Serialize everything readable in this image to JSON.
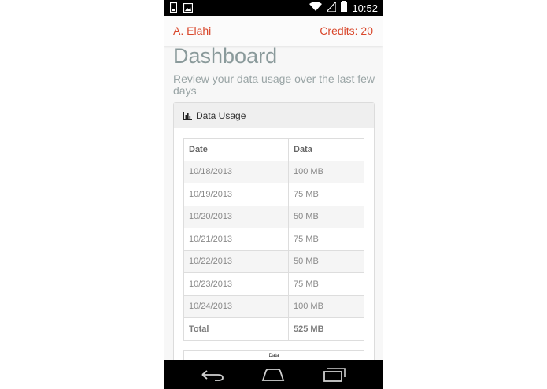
{
  "statusbar": {
    "time": "10:52",
    "left_icons": [
      "phone-notification-icon",
      "image-notification-icon"
    ],
    "right_icons": [
      "wifi-icon",
      "signal-icon",
      "battery-icon"
    ]
  },
  "header": {
    "user_name": "A. Elahi",
    "credits": "Credits: 20",
    "accent_color": "#d9472b"
  },
  "page": {
    "title": "Dashboard",
    "subtitle": "Review your data usage over the last few days"
  },
  "panel": {
    "icon": "bar-chart-icon",
    "title": "Data Usage",
    "table": {
      "columns": [
        "Date",
        "Data"
      ],
      "rows": [
        {
          "date": "10/18/2013",
          "data": "100 MB"
        },
        {
          "date": "10/19/2013",
          "data": "75 MB"
        },
        {
          "date": "10/20/2013",
          "data": "50 MB"
        },
        {
          "date": "10/21/2013",
          "data": "75 MB"
        },
        {
          "date": "10/22/2013",
          "data": "50 MB"
        },
        {
          "date": "10/23/2013",
          "data": "75 MB"
        },
        {
          "date": "10/24/2013",
          "data": "100 MB"
        }
      ],
      "total_label": "Total",
      "total_value": "525 MB"
    },
    "chart_title": "Data"
  },
  "navbar": {
    "icons": [
      "back-icon",
      "home-icon",
      "recent-apps-icon"
    ]
  }
}
